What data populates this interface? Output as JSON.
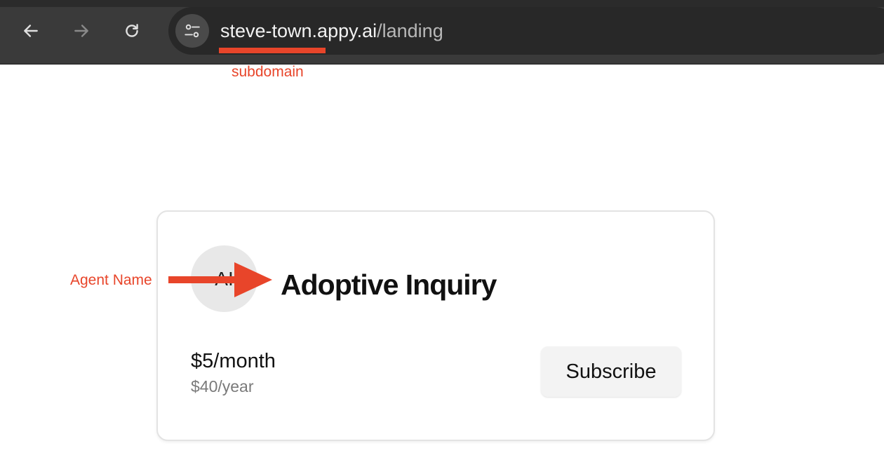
{
  "browser": {
    "back_icon": "arrow-left-icon",
    "forward_icon": "arrow-right-icon",
    "reload_icon": "reload-icon",
    "site_info_icon": "tune-icon",
    "url_host": "steve-town.appy.ai",
    "url_path": "/landing"
  },
  "annotations": {
    "subdomain_label": "subdomain",
    "agent_name_label": "Agent Name",
    "color": "#e8452a"
  },
  "card": {
    "avatar_text": "AI",
    "agent_name": "Adoptive Inquiry",
    "price_monthly": "$5/month",
    "price_yearly": "$40/year",
    "subscribe_label": "Subscribe"
  }
}
